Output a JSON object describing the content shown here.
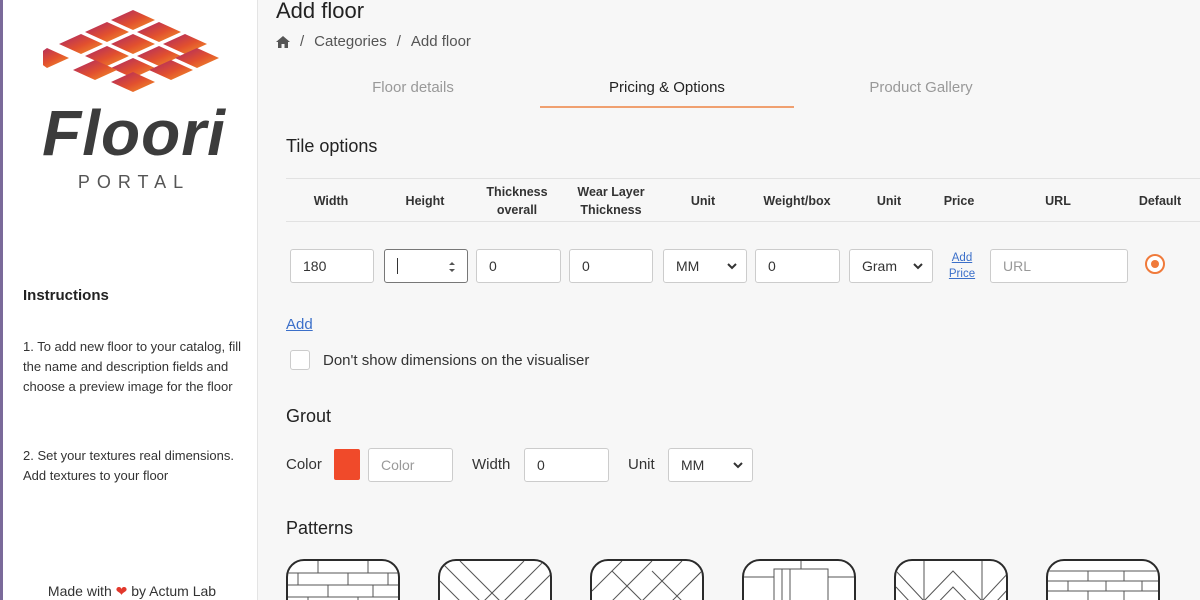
{
  "sidebar": {
    "logo_text": "Floori",
    "logo_sub": "PORTAL",
    "instructions_title": "Instructions",
    "instructions": [
      "1. To add new floor to your catalog, fill the name and description fields and choose a preview image for the floor",
      "2. Set your textures real dimensions. Add textures to your floor"
    ],
    "made_with_prefix": "Made with",
    "made_with_suffix": "by Actum Lab"
  },
  "header": {
    "title": "Add floor",
    "breadcrumb": [
      "Categories",
      "Add floor"
    ],
    "separator": "/"
  },
  "tabs": [
    {
      "label": "Floor details",
      "active": false
    },
    {
      "label": "Pricing & Options",
      "active": true
    },
    {
      "label": "Product Gallery",
      "active": false
    }
  ],
  "tile_options": {
    "title": "Tile options",
    "columns": [
      "Width",
      "Height",
      "Thickness overall",
      "Wear Layer Thickness",
      "Unit",
      "Weight/box",
      "Unit",
      "Price",
      "URL",
      "Default"
    ],
    "row": {
      "width": "180",
      "height": "",
      "thickness": "0",
      "wear_layer": "0",
      "unit": "MM",
      "weight": "0",
      "weight_unit": "Gram",
      "price_link": "Add Price",
      "url_placeholder": "URL",
      "default_selected": true
    },
    "add_link": "Add",
    "checkbox_label": "Don't show dimensions on the visualiser"
  },
  "grout": {
    "title": "Grout",
    "color_label": "Color",
    "color_swatch": "#f04a2a",
    "color_placeholder": "Color",
    "width_label": "Width",
    "width_value": "0",
    "unit_label": "Unit",
    "unit_value": "MM"
  },
  "patterns": {
    "title": "Patterns",
    "items": [
      "brick",
      "herringbone",
      "diagonal",
      "basketweave",
      "chevron",
      "stacked-brick"
    ]
  },
  "colors": {
    "accent": "#f07a3a",
    "link": "#3b6fc9"
  }
}
